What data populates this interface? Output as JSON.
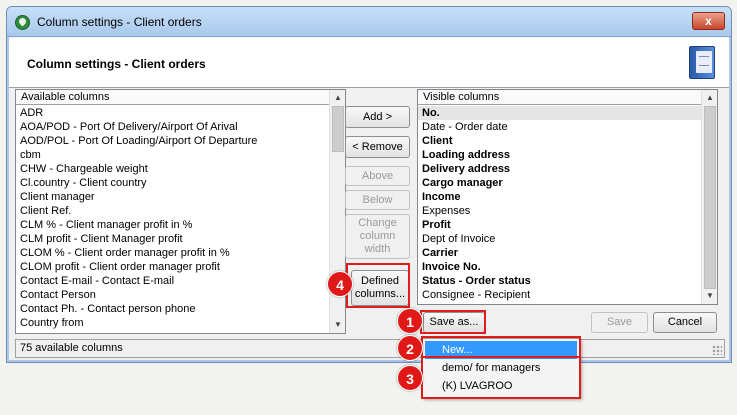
{
  "window": {
    "title": "Column settings - Client orders",
    "close_glyph": "x"
  },
  "header": {
    "title": "Column settings - Client orders",
    "icon": "book-icon"
  },
  "available": {
    "header": "Available columns",
    "items": [
      "ADR",
      "AOA/POD - Port Of Delivery/Airport Of Arival",
      "AOD/POL - Port Of Loading/Airport Of Departure",
      "cbm",
      "CHW - Chargeable weight",
      "Cl.country - Client country",
      "Client manager",
      "Client Ref.",
      "CLM % - Client manager profit in %",
      "CLM profit - Client Manager profit",
      "CLOM % - Client order manager profit in %",
      "CLOM profit - Client order manager profit",
      "Contact E-mail - Contact E-mail",
      "Contact Person",
      "Contact Ph. - Contact person phone",
      "Country from"
    ]
  },
  "visible": {
    "header": "Visible columns",
    "items": [
      {
        "label": "No.",
        "bold": true
      },
      {
        "label": "Date - Order date",
        "bold": false
      },
      {
        "label": "Client",
        "bold": true
      },
      {
        "label": "Loading address",
        "bold": true
      },
      {
        "label": "Delivery address",
        "bold": true
      },
      {
        "label": "Cargo manager",
        "bold": true
      },
      {
        "label": "Income",
        "bold": true
      },
      {
        "label": "Expenses",
        "bold": false
      },
      {
        "label": "Profit",
        "bold": true
      },
      {
        "label": "Dept of Invoice",
        "bold": false
      },
      {
        "label": "Carrier",
        "bold": true
      },
      {
        "label": "Invoice No.",
        "bold": true
      },
      {
        "label": "Status - Order status",
        "bold": true
      },
      {
        "label": "Consignee - Recipient",
        "bold": false
      }
    ]
  },
  "buttons": {
    "add": "Add >",
    "remove": "< Remove",
    "above": "Above",
    "below": "Below",
    "change_width": [
      "Change",
      "column",
      "width"
    ],
    "defined_columns": [
      "Defined",
      "columns..."
    ],
    "save_as": "Save as...",
    "save": "Save",
    "cancel": "Cancel"
  },
  "status": {
    "text": "75 available columns"
  },
  "save_as_menu": {
    "items": [
      "New...",
      "demo/ for managers",
      "(K) LVAGROO"
    ],
    "active_index": 0
  },
  "callouts": [
    "1",
    "2",
    "3",
    "4"
  ],
  "colors": {
    "highlight": "#3399ff",
    "callout": "#e01818",
    "titlebar": "#b8d4f2"
  }
}
